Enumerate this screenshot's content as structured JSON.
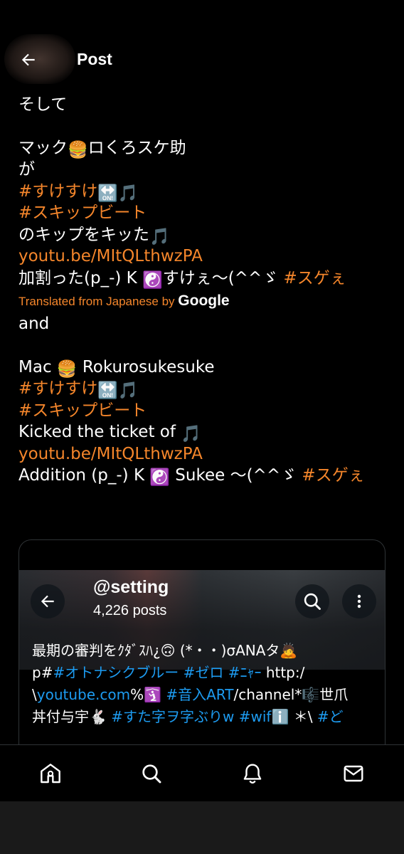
{
  "header": {
    "title": "Post"
  },
  "post": {
    "original_lines": [
      [
        {
          "t": "そして"
        }
      ],
      [],
      [
        {
          "t": "マック"
        },
        {
          "t": "🍔",
          "e": true
        },
        {
          "t": "ロくろスケ助"
        }
      ],
      [
        {
          "t": "が"
        }
      ],
      [
        {
          "t": "#すけすけ",
          "c": "tag"
        },
        {
          "t": "🔛",
          "e": true
        },
        {
          "t": "🎵",
          "e": true
        }
      ],
      [
        {
          "t": "#スキップビート",
          "c": "tag"
        }
      ],
      [
        {
          "t": "のキップをキッた"
        },
        {
          "t": "🎵",
          "e": true
        }
      ],
      [
        {
          "t": "youtu.be/MItQLthwzPA",
          "c": "link"
        }
      ],
      [
        {
          "t": "加割った(p_-) K "
        },
        {
          "t": "☯️",
          "e": true
        },
        {
          "t": "すけぇ〜(^^ゞ "
        },
        {
          "t": "#スゲぇ",
          "c": "tag"
        }
      ]
    ],
    "translated_label": "Translated from Japanese by",
    "translated_brand": "Google",
    "translation_lines": [
      [
        {
          "t": "and"
        }
      ],
      [],
      [
        {
          "t": "Mac "
        },
        {
          "t": "🍔",
          "e": true
        },
        {
          "t": " Rokurosukesuke"
        }
      ],
      [
        {
          "t": "#すけすけ",
          "c": "tag"
        },
        {
          "t": "🔛",
          "e": true
        },
        {
          "t": "🎵",
          "e": true
        }
      ],
      [
        {
          "t": "#スキップビート",
          "c": "tag"
        }
      ],
      [
        {
          "t": "Kicked the ticket of "
        },
        {
          "t": "🎵",
          "e": true
        }
      ],
      [
        {
          "t": "youtu.be/MItQLthwzPA",
          "c": "link"
        }
      ],
      [
        {
          "t": "Addition (p_-) K "
        },
        {
          "t": "☯️",
          "e": true
        },
        {
          "t": " Sukee 〜(^^ゞ "
        },
        {
          "t": "#スゲぇ",
          "c": "tag"
        }
      ]
    ]
  },
  "card": {
    "handle": "@setting",
    "posts_count": "4,226 posts",
    "bio_lines": [
      [
        {
          "t": "最期の審判をｸﾀﾞｽﾊ¿🙃 (*・・)σANAタ🙇"
        }
      ],
      [
        {
          "t": "p#"
        },
        {
          "t": "#オトナシクブルー",
          "c": "blue"
        },
        {
          "t": " "
        },
        {
          "t": "#ゼロ",
          "c": "blue"
        },
        {
          "t": " "
        },
        {
          "t": "#ﾆｬｰ",
          "c": "blue"
        },
        {
          "t": " http:/"
        }
      ],
      [
        {
          "t": "\\"
        },
        {
          "t": "youtube.com",
          "c": "blue"
        },
        {
          "t": "%🛐 "
        },
        {
          "t": "#音入ART",
          "c": "blue"
        },
        {
          "t": "/channel*🎼世爪"
        }
      ],
      [
        {
          "t": "丼付与宇🐇 "
        },
        {
          "t": "#すた字ヲ字ぶりw",
          "c": "blue"
        },
        {
          "t": " "
        },
        {
          "t": "#wif",
          "c": "blue"
        },
        {
          "t": "ℹ️ ＊\\ "
        },
        {
          "t": "#ど",
          "c": "blue"
        }
      ]
    ]
  },
  "nav": {
    "items": [
      "home-icon",
      "search-icon",
      "notifications-icon",
      "messages-icon"
    ]
  },
  "colors": {
    "accent": "#f5862b",
    "link_blue": "#1d9bf0",
    "background": "#000000"
  }
}
